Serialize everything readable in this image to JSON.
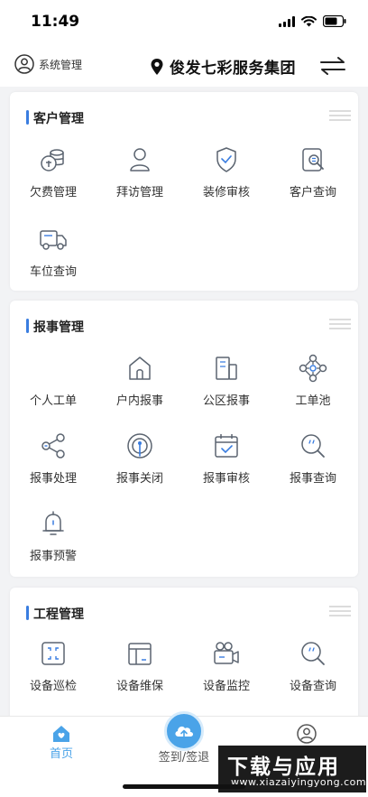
{
  "status_bar": {
    "time": "11:49"
  },
  "header": {
    "system_label": "系统管理",
    "org_name": "俊发七彩服务集团"
  },
  "sections": {
    "customer": {
      "title": "客户管理",
      "items": [
        "欠费管理",
        "拜访管理",
        "装修审核",
        "客户查询",
        "车位查询"
      ]
    },
    "report": {
      "title": "报事管理",
      "items": [
        "个人工单",
        "户内报事",
        "公区报事",
        "工单池",
        "报事处理",
        "报事关闭",
        "报事审核",
        "报事查询",
        "报事预警"
      ]
    },
    "engineering": {
      "title": "工程管理",
      "items": [
        "设备巡检",
        "设备维保",
        "设备监控",
        "设备查询"
      ]
    }
  },
  "tabbar": {
    "home": "首页",
    "checkin": "签到/签退",
    "mine": ""
  },
  "watermark": {
    "main": "下载与应用",
    "sub": "www.xiazaiyingyong.com"
  },
  "colors": {
    "accent": "#3a7de0",
    "tab_active": "#4aa3e8",
    "icon": "#5b6470"
  }
}
